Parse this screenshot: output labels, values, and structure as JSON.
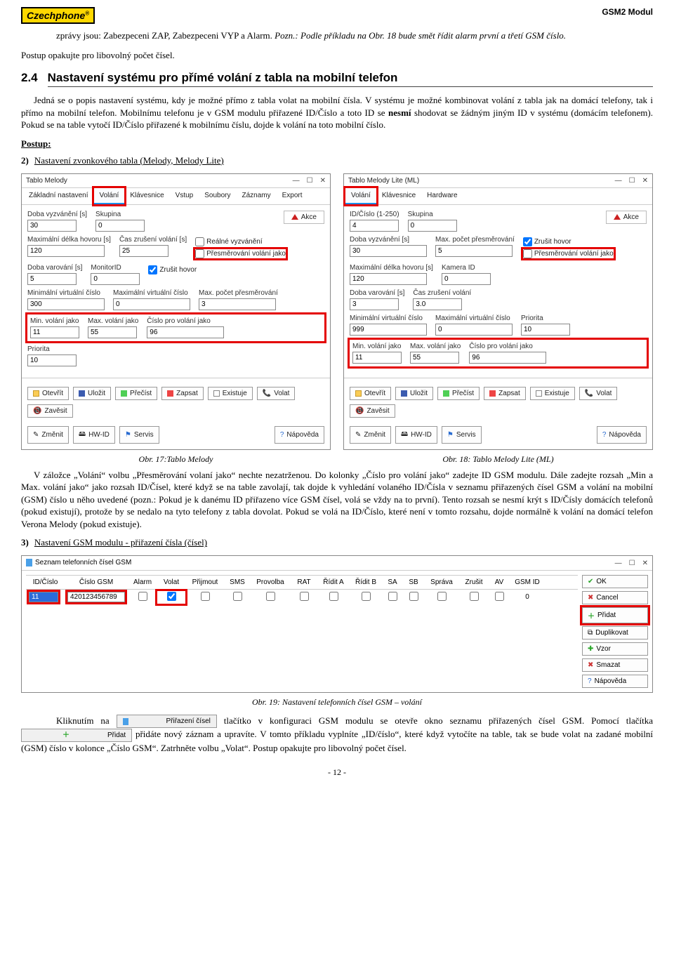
{
  "header": {
    "logo": "Czechphone",
    "logo_reg": "®",
    "doc_name": "GSM2 Modul"
  },
  "intro": {
    "p1a": "zprávy jsou: Zabezpeceni ZAP, Zabezpeceni VYP a Alarm. ",
    "p1b": "Pozn.: Podle příkladu na Obr. 18 bude smět řídit alarm první a třetí GSM číslo.",
    "p2": "Postup opakujte pro libovolný počet čísel.",
    "h2_num": "2.4",
    "h2_txt": "Nastavení systému pro přímé volání z tabla na mobilní telefon",
    "p3a": "Jedná se o popis nastavení systému, kdy je možné přímo z tabla volat na mobilní čísla. V systému je možné kombinovat volání z tabla jak na domácí telefony, tak i přímo na mobilní telefon. Mobilnímu telefonu je v GSM modulu přiřazené ID/Číslo a toto ID se ",
    "p3b": "nesmí",
    "p3c": " shodovat se žádným jiným ID v systému (domácím telefonem). Pokud se na table vytočí ID/Číslo přiřazené k mobilnímu číslu, dojde k volání na toto mobilní číslo.",
    "postup": "Postup:",
    "step2_num": "2)",
    "step2_title": "Nastavení zvonkového tabla (Melody, Melody Lite)"
  },
  "melody": {
    "title": "Tablo Melody",
    "tabs": [
      "Základní nastavení",
      "Volání",
      "Klávesnice",
      "Vstup",
      "Soubory",
      "Záznamy",
      "Export"
    ],
    "f": {
      "doba_vyzvaneni_l": "Doba vyzvánění [s]",
      "doba_vyzvaneni_v": "30",
      "skupina_l": "Skupina",
      "skupina_v": "0",
      "max_hovor_l": "Maximální délka hovoru [s]",
      "max_hovor_v": "120",
      "cas_zrus_l": "Čas zrušení volání [s]",
      "cas_zrus_v": "25",
      "doba_var_l": "Doba varování [s]",
      "doba_var_v": "5",
      "monitorid_l": "MonitorID",
      "monitorid_v": "0",
      "min_virt_l": "Minimální virtuální číslo",
      "min_virt_v": "300",
      "max_virt_l": "Maximální virtuální číslo",
      "max_virt_v": "0",
      "max_presm_l": "Max. počet přesměrování",
      "max_presm_v": "3",
      "min_vol_l": "Min. volání jako",
      "min_vol_v": "11",
      "max_vol_l": "Max. volání jako",
      "max_vol_v": "55",
      "cislo_pro_l": "Číslo pro volání jako",
      "cislo_pro_v": "96",
      "priorita_l": "Priorita",
      "priorita_v": "10"
    },
    "chk": {
      "realne": "Reálné vyzvánění",
      "presm": "Přesměrování volání jako",
      "zrusit": "Zrušit hovor"
    },
    "akce": "Akce"
  },
  "melodyLite": {
    "title": "Tablo Melody Lite (ML)",
    "tabs": [
      "Volání",
      "Klávesnice",
      "Hardware"
    ],
    "f": {
      "idc_l": "ID/Číslo (1-250)",
      "idc_v": "4",
      "skupina_l": "Skupina",
      "skupina_v": "0",
      "doba_vyz_l": "Doba vyzvánění [s]",
      "doba_vyz_v": "30",
      "max_presm_l": "Max. počet přesměrování",
      "max_presm_v": "5",
      "max_hovor_l": "Maximální délka hovoru [s]",
      "max_hovor_v": "120",
      "kamera_l": "Kamera ID",
      "kamera_v": "0",
      "doba_var_l": "Doba varování [s]",
      "doba_var_v": "3",
      "cas_zrus_l": "Čas zrušení volání",
      "cas_zrus_v": "3.0",
      "min_virt_l": "Minimální virtuální číslo",
      "min_virt_v": "999",
      "max_virt_l": "Maximální virtuální číslo",
      "max_virt_v": "0",
      "priorita_l": "Priorita",
      "priorita_v": "10",
      "min_vol_l": "Min. volání jako",
      "min_vol_v": "11",
      "max_vol_l": "Max. volání jako",
      "max_vol_v": "55",
      "cislo_pro_l": "Číslo pro volání jako",
      "cislo_pro_v": "96"
    },
    "chk": {
      "zrusit": "Zrušit hovor",
      "presm": "Přesměrování volání jako"
    },
    "akce": "Akce"
  },
  "bottomBtns": {
    "otevrit": "Otevřít",
    "ulozit": "Uložit",
    "precist": "Přečíst",
    "zapsat": "Zapsat",
    "existuje": "Existuje",
    "volat": "Volat",
    "zavesit": "Zavěsit",
    "zmenit": "Změnit",
    "hwid": "HW-ID",
    "servis": "Servis",
    "napoveda": "Nápověda"
  },
  "figcaps": {
    "left": "Obr. 17:Tablo Melody",
    "right": "Obr. 18: Tablo Melody Lite (ML)"
  },
  "mid": {
    "p": "V záložce „Volání“ volbu „Přesměrování volaní jako“ nechte nezatrženou. Do kolonky „Číslo pro volání jako“ zadejte ID GSM modulu. Dále zadejte rozsah „Min a Max. volání jako“ jako rozsah ID/Čísel, které když se na table zavolají, tak dojde k vyhledání volaného ID/Čísla v seznamu přiřazených čísel GSM a volání na mobilní (GSM) číslo u něho uvedené (pozn.: Pokud je k danému ID přiřazeno více GSM čísel, volá se vždy na to první). Tento rozsah se nesmí krýt s ID/Čísly domácích telefonů (pokud existují), protože by se nedalo na tyto telefony z tabla dovolat. Pokud se volá na ID/Číslo, které není v tomto rozsahu, dojde normálně k volání na domácí telefon Verona Melody (pokud existuje).",
    "step3_num": "3)",
    "step3_title": "Nastavení GSM modulu - přiřazení čísla (čísel)"
  },
  "gsm": {
    "title": "Seznam telefonních čísel GSM",
    "cols": [
      "ID/Číslo",
      "Číslo GSM",
      "Alarm",
      "Volat",
      "Přijmout",
      "SMS",
      "Provolba",
      "RAT",
      "Řídit A",
      "Řídit B",
      "SA",
      "SB",
      "Správa",
      "Zrušit",
      "AV",
      "GSM ID"
    ],
    "row": {
      "id": "11",
      "gsm": "420123456789",
      "alarm": false,
      "volat": true,
      "prijmout": false,
      "sms": false,
      "provolba": false,
      "rat": false,
      "ridita": false,
      "riditb": false,
      "sa": false,
      "sb": false,
      "sprava": false,
      "zrusit": false,
      "av": false,
      "gsmid": "0"
    },
    "side": {
      "ok": "OK",
      "cancel": "Cancel",
      "pridat": "Přidat",
      "dup": "Duplikovat",
      "vzor": "Vzor",
      "smazat": "Smazat",
      "napoveda": "Nápověda"
    },
    "cap": "Obr. 19: Nastavení telefonních čísel GSM – volání"
  },
  "tail": {
    "a1": "Kliknutím na ",
    "btn1": "Přiřazení čísel",
    "a2": " tlačítko v konfiguraci GSM modulu se otevře okno seznamu přiřazených čísel GSM. Pomocí tlačítka ",
    "btn2": "Přidat",
    "a3": " přidáte nový záznam a upravíte. V tomto příkladu vyplníte „ID/číslo“, které když vytočíte na table, tak se bude volat na zadané mobilní (GSM) číslo v kolonce „Číslo GSM“. Zatrhněte volbu „Volat“. Postup opakujte pro libovolný počet čísel."
  },
  "footer": {
    "page": "- 12 -"
  }
}
